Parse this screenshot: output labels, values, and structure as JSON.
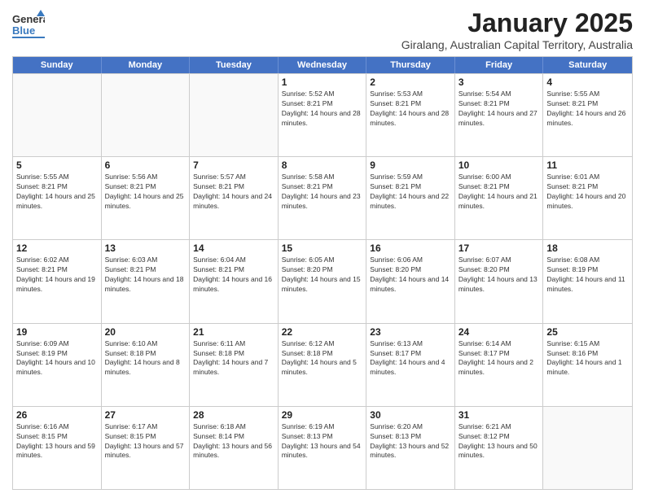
{
  "header": {
    "logo_general": "General",
    "logo_blue": "Blue",
    "month": "January 2025",
    "location": "Giralang, Australian Capital Territory, Australia"
  },
  "days_of_week": [
    "Sunday",
    "Monday",
    "Tuesday",
    "Wednesday",
    "Thursday",
    "Friday",
    "Saturday"
  ],
  "weeks": [
    [
      {
        "day": "",
        "sunrise": "",
        "sunset": "",
        "daylight": "",
        "empty": true
      },
      {
        "day": "",
        "sunrise": "",
        "sunset": "",
        "daylight": "",
        "empty": true
      },
      {
        "day": "",
        "sunrise": "",
        "sunset": "",
        "daylight": "",
        "empty": true
      },
      {
        "day": "1",
        "sunrise": "Sunrise: 5:52 AM",
        "sunset": "Sunset: 8:21 PM",
        "daylight": "Daylight: 14 hours and 28 minutes.",
        "empty": false
      },
      {
        "day": "2",
        "sunrise": "Sunrise: 5:53 AM",
        "sunset": "Sunset: 8:21 PM",
        "daylight": "Daylight: 14 hours and 28 minutes.",
        "empty": false
      },
      {
        "day": "3",
        "sunrise": "Sunrise: 5:54 AM",
        "sunset": "Sunset: 8:21 PM",
        "daylight": "Daylight: 14 hours and 27 minutes.",
        "empty": false
      },
      {
        "day": "4",
        "sunrise": "Sunrise: 5:55 AM",
        "sunset": "Sunset: 8:21 PM",
        "daylight": "Daylight: 14 hours and 26 minutes.",
        "empty": false
      }
    ],
    [
      {
        "day": "5",
        "sunrise": "Sunrise: 5:55 AM",
        "sunset": "Sunset: 8:21 PM",
        "daylight": "Daylight: 14 hours and 25 minutes.",
        "empty": false
      },
      {
        "day": "6",
        "sunrise": "Sunrise: 5:56 AM",
        "sunset": "Sunset: 8:21 PM",
        "daylight": "Daylight: 14 hours and 25 minutes.",
        "empty": false
      },
      {
        "day": "7",
        "sunrise": "Sunrise: 5:57 AM",
        "sunset": "Sunset: 8:21 PM",
        "daylight": "Daylight: 14 hours and 24 minutes.",
        "empty": false
      },
      {
        "day": "8",
        "sunrise": "Sunrise: 5:58 AM",
        "sunset": "Sunset: 8:21 PM",
        "daylight": "Daylight: 14 hours and 23 minutes.",
        "empty": false
      },
      {
        "day": "9",
        "sunrise": "Sunrise: 5:59 AM",
        "sunset": "Sunset: 8:21 PM",
        "daylight": "Daylight: 14 hours and 22 minutes.",
        "empty": false
      },
      {
        "day": "10",
        "sunrise": "Sunrise: 6:00 AM",
        "sunset": "Sunset: 8:21 PM",
        "daylight": "Daylight: 14 hours and 21 minutes.",
        "empty": false
      },
      {
        "day": "11",
        "sunrise": "Sunrise: 6:01 AM",
        "sunset": "Sunset: 8:21 PM",
        "daylight": "Daylight: 14 hours and 20 minutes.",
        "empty": false
      }
    ],
    [
      {
        "day": "12",
        "sunrise": "Sunrise: 6:02 AM",
        "sunset": "Sunset: 8:21 PM",
        "daylight": "Daylight: 14 hours and 19 minutes.",
        "empty": false
      },
      {
        "day": "13",
        "sunrise": "Sunrise: 6:03 AM",
        "sunset": "Sunset: 8:21 PM",
        "daylight": "Daylight: 14 hours and 18 minutes.",
        "empty": false
      },
      {
        "day": "14",
        "sunrise": "Sunrise: 6:04 AM",
        "sunset": "Sunset: 8:21 PM",
        "daylight": "Daylight: 14 hours and 16 minutes.",
        "empty": false
      },
      {
        "day": "15",
        "sunrise": "Sunrise: 6:05 AM",
        "sunset": "Sunset: 8:20 PM",
        "daylight": "Daylight: 14 hours and 15 minutes.",
        "empty": false
      },
      {
        "day": "16",
        "sunrise": "Sunrise: 6:06 AM",
        "sunset": "Sunset: 8:20 PM",
        "daylight": "Daylight: 14 hours and 14 minutes.",
        "empty": false
      },
      {
        "day": "17",
        "sunrise": "Sunrise: 6:07 AM",
        "sunset": "Sunset: 8:20 PM",
        "daylight": "Daylight: 14 hours and 13 minutes.",
        "empty": false
      },
      {
        "day": "18",
        "sunrise": "Sunrise: 6:08 AM",
        "sunset": "Sunset: 8:19 PM",
        "daylight": "Daylight: 14 hours and 11 minutes.",
        "empty": false
      }
    ],
    [
      {
        "day": "19",
        "sunrise": "Sunrise: 6:09 AM",
        "sunset": "Sunset: 8:19 PM",
        "daylight": "Daylight: 14 hours and 10 minutes.",
        "empty": false
      },
      {
        "day": "20",
        "sunrise": "Sunrise: 6:10 AM",
        "sunset": "Sunset: 8:18 PM",
        "daylight": "Daylight: 14 hours and 8 minutes.",
        "empty": false
      },
      {
        "day": "21",
        "sunrise": "Sunrise: 6:11 AM",
        "sunset": "Sunset: 8:18 PM",
        "daylight": "Daylight: 14 hours and 7 minutes.",
        "empty": false
      },
      {
        "day": "22",
        "sunrise": "Sunrise: 6:12 AM",
        "sunset": "Sunset: 8:18 PM",
        "daylight": "Daylight: 14 hours and 5 minutes.",
        "empty": false
      },
      {
        "day": "23",
        "sunrise": "Sunrise: 6:13 AM",
        "sunset": "Sunset: 8:17 PM",
        "daylight": "Daylight: 14 hours and 4 minutes.",
        "empty": false
      },
      {
        "day": "24",
        "sunrise": "Sunrise: 6:14 AM",
        "sunset": "Sunset: 8:17 PM",
        "daylight": "Daylight: 14 hours and 2 minutes.",
        "empty": false
      },
      {
        "day": "25",
        "sunrise": "Sunrise: 6:15 AM",
        "sunset": "Sunset: 8:16 PM",
        "daylight": "Daylight: 14 hours and 1 minute.",
        "empty": false
      }
    ],
    [
      {
        "day": "26",
        "sunrise": "Sunrise: 6:16 AM",
        "sunset": "Sunset: 8:15 PM",
        "daylight": "Daylight: 13 hours and 59 minutes.",
        "empty": false
      },
      {
        "day": "27",
        "sunrise": "Sunrise: 6:17 AM",
        "sunset": "Sunset: 8:15 PM",
        "daylight": "Daylight: 13 hours and 57 minutes.",
        "empty": false
      },
      {
        "day": "28",
        "sunrise": "Sunrise: 6:18 AM",
        "sunset": "Sunset: 8:14 PM",
        "daylight": "Daylight: 13 hours and 56 minutes.",
        "empty": false
      },
      {
        "day": "29",
        "sunrise": "Sunrise: 6:19 AM",
        "sunset": "Sunset: 8:13 PM",
        "daylight": "Daylight: 13 hours and 54 minutes.",
        "empty": false
      },
      {
        "day": "30",
        "sunrise": "Sunrise: 6:20 AM",
        "sunset": "Sunset: 8:13 PM",
        "daylight": "Daylight: 13 hours and 52 minutes.",
        "empty": false
      },
      {
        "day": "31",
        "sunrise": "Sunrise: 6:21 AM",
        "sunset": "Sunset: 8:12 PM",
        "daylight": "Daylight: 13 hours and 50 minutes.",
        "empty": false
      },
      {
        "day": "",
        "sunrise": "",
        "sunset": "",
        "daylight": "",
        "empty": true
      }
    ]
  ]
}
